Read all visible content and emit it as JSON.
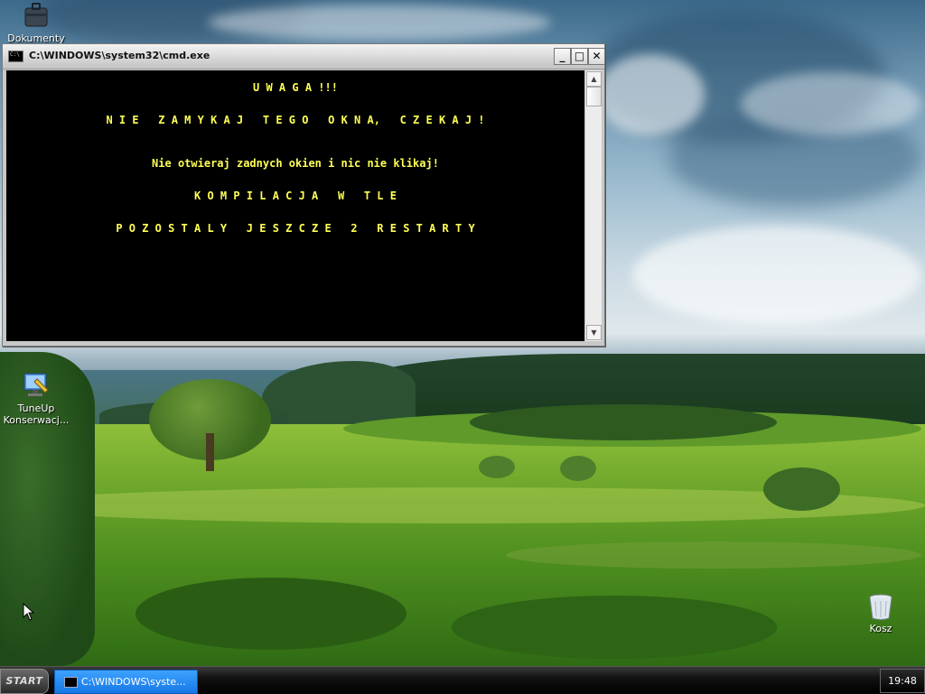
{
  "desktop": {
    "icons": [
      {
        "label": "Dokumenty",
        "icon": "briefcase-icon"
      },
      {
        "label": "TuneUp Konserwacj...",
        "icon": "tuneup-monitor-icon"
      },
      {
        "label": "Kosz",
        "icon": "recycle-bin-icon"
      }
    ]
  },
  "cmd_window": {
    "title": "C:\\WINDOWS\\system32\\cmd.exe",
    "buttons": {
      "minimize": "_",
      "maximize": "□",
      "close": "✕"
    },
    "text_color": "#ffff55",
    "lines": [
      "U W A G A !!!",
      "N I E   Z A M Y K A J   T E G O   O K N A,   C Z E K A J !",
      "Nie otwieraj zadnych okien i nic nie klikaj!",
      "K O M P I L A C J A   W   T L E",
      "P O Z O S T A L Y   J E S Z C Z E   2   R E S T A R T Y"
    ]
  },
  "taskbar": {
    "start_label": "START",
    "tasks": [
      {
        "label": "C:\\WINDOWS\\syste..."
      }
    ],
    "clock": "19:48"
  }
}
